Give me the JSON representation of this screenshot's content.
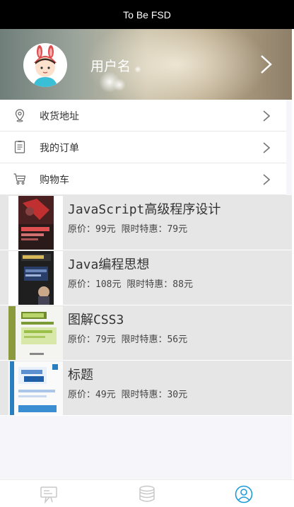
{
  "header": {
    "title": "To Be FSD"
  },
  "profile": {
    "username": "用户名"
  },
  "menu": {
    "items": [
      {
        "label": "收货地址",
        "icon": "location-pin-icon"
      },
      {
        "label": "我的订单",
        "icon": "order-list-icon"
      },
      {
        "label": "购物车",
        "icon": "cart-icon"
      }
    ]
  },
  "books": [
    {
      "title": "JavaScript高级程序设计",
      "price": "原价：99元  限时特惠：79元"
    },
    {
      "title": "Java编程思想",
      "price": "原价：108元 限时特惠：88元"
    },
    {
      "title": "图解CSS3",
      "price": "原价：79元  限时特惠：56元"
    },
    {
      "title": "标题",
      "price": "原价：49元  限时特惠：30元"
    }
  ],
  "tabbar": {
    "tabs": [
      {
        "icon": "chat-board-icon",
        "active": false
      },
      {
        "icon": "database-icon",
        "active": false
      },
      {
        "icon": "user-profile-icon",
        "active": true
      }
    ],
    "active_color": "#1e9bd7",
    "inactive_color": "#c8c8c8"
  }
}
